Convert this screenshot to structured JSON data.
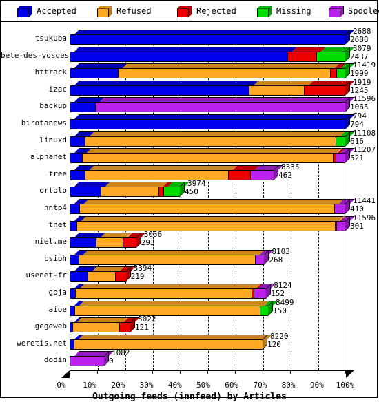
{
  "legend": {
    "items": [
      {
        "label": "Accepted",
        "color": "#0000ee",
        "icon": "cube-icon"
      },
      {
        "label": "Refused",
        "color": "#ffa824",
        "icon": "cube-icon"
      },
      {
        "label": "Rejected",
        "color": "#ee0000",
        "icon": "cube-icon"
      },
      {
        "label": "Missing",
        "color": "#00dd00",
        "icon": "cube-icon"
      },
      {
        "label": "Spooled",
        "color": "#bb22ee",
        "icon": "cube-icon"
      }
    ]
  },
  "axis": {
    "x_title": "Outgoing feeds (innfeed) by Articles",
    "ticks": [
      "0%",
      "10%",
      "20%",
      "30%",
      "40%",
      "50%",
      "60%",
      "70%",
      "80%",
      "90%",
      "100%"
    ]
  },
  "chart_data": {
    "type": "bar",
    "orientation": "horizontal",
    "stacked": true,
    "normalized": true,
    "title": "Outgoing feeds (innfeed) by Articles",
    "xlabel": "Outgoing feeds (innfeed) by Articles",
    "ylabel": "",
    "xlim": [
      0,
      100
    ],
    "xticks": [
      0,
      10,
      20,
      30,
      40,
      50,
      60,
      70,
      80,
      90,
      100
    ],
    "xticklabels": [
      "0%",
      "10%",
      "20%",
      "30%",
      "40%",
      "50%",
      "60%",
      "70%",
      "80%",
      "90%",
      "100%"
    ],
    "grid": "vertical-dashed",
    "legend_position": "top",
    "series_names": [
      "Accepted",
      "Refused",
      "Rejected",
      "Missing",
      "Spooled"
    ],
    "series_colors": [
      "#0000ee",
      "#ffa824",
      "#ee0000",
      "#00dd00",
      "#bb22ee"
    ],
    "categories": [
      "tsukuba",
      "bete-des-vosges",
      "httrack",
      "izac",
      "backup",
      "birotanews",
      "linuxd",
      "alphanet",
      "free",
      "ortolo",
      "nntp4",
      "tnet",
      "niel.me",
      "csiph",
      "usenet-fr",
      "goja",
      "aioe",
      "gegeweb",
      "weretis.net",
      "dodin"
    ],
    "value_labels": [
      {
        "name": "tsukuba",
        "total": "2688",
        "second": "2688"
      },
      {
        "name": "bete-des-vosges",
        "total": "3079",
        "second": "2437"
      },
      {
        "name": "httrack",
        "total": "11419",
        "second": "1999"
      },
      {
        "name": "izac",
        "total": "1919",
        "second": "1245"
      },
      {
        "name": "backup",
        "total": "11596",
        "second": "1065"
      },
      {
        "name": "birotanews",
        "total": "794",
        "second": "794"
      },
      {
        "name": "linuxd",
        "total": "11108",
        "second": "616"
      },
      {
        "name": "alphanet",
        "total": "11207",
        "second": "521"
      },
      {
        "name": "free",
        "total": "8335",
        "second": "462"
      },
      {
        "name": "ortolo",
        "total": "3974",
        "second": "450"
      },
      {
        "name": "nntp4",
        "total": "11441",
        "second": "410"
      },
      {
        "name": "tnet",
        "total": "11596",
        "second": "301"
      },
      {
        "name": "niel.me",
        "total": "3056",
        "second": "293"
      },
      {
        "name": "csiph",
        "total": "8103",
        "second": "268"
      },
      {
        "name": "usenet-fr",
        "total": "3394",
        "second": "219"
      },
      {
        "name": "goja",
        "total": "8124",
        "second": "152"
      },
      {
        "name": "aioe",
        "total": "8499",
        "second": "150"
      },
      {
        "name": "gegeweb",
        "total": "3022",
        "second": "121"
      },
      {
        "name": "weretis.net",
        "total": "8220",
        "second": "120"
      },
      {
        "name": "dodin",
        "total": "1082",
        "second": "0"
      }
    ],
    "rows": [
      {
        "name": "tsukuba",
        "segments": [
          {
            "series": "Accepted",
            "pct": 100.0
          }
        ]
      },
      {
        "name": "bete-des-vosges",
        "segments": [
          {
            "series": "Accepted",
            "pct": 79.1
          },
          {
            "series": "Rejected",
            "pct": 10.4
          },
          {
            "series": "Missing",
            "pct": 10.5
          }
        ]
      },
      {
        "name": "httrack",
        "segments": [
          {
            "series": "Accepted",
            "pct": 17.5
          },
          {
            "series": "Refused",
            "pct": 77.0
          },
          {
            "series": "Rejected",
            "pct": 2.2
          },
          {
            "series": "Missing",
            "pct": 3.3
          }
        ]
      },
      {
        "name": "izac",
        "segments": [
          {
            "series": "Accepted",
            "pct": 64.9
          },
          {
            "series": "Refused",
            "pct": 20.0
          },
          {
            "series": "Rejected",
            "pct": 15.1
          }
        ]
      },
      {
        "name": "backup",
        "segments": [
          {
            "series": "Accepted",
            "pct": 9.2
          },
          {
            "series": "Spooled",
            "pct": 90.8
          }
        ]
      },
      {
        "name": "birotanews",
        "segments": [
          {
            "series": "Accepted",
            "pct": 100.0
          }
        ]
      },
      {
        "name": "linuxd",
        "segments": [
          {
            "series": "Accepted",
            "pct": 5.5
          },
          {
            "series": "Refused",
            "pct": 91.0
          },
          {
            "series": "Missing",
            "pct": 3.5
          }
        ]
      },
      {
        "name": "alphanet",
        "segments": [
          {
            "series": "Accepted",
            "pct": 4.6
          },
          {
            "series": "Refused",
            "pct": 90.8
          },
          {
            "series": "Rejected",
            "pct": 1.1
          },
          {
            "series": "Spooled",
            "pct": 3.5
          }
        ]
      },
      {
        "name": "free",
        "segments": [
          {
            "series": "Accepted",
            "pct": 5.5
          },
          {
            "series": "Refused",
            "pct": 52.0
          },
          {
            "series": "Rejected",
            "pct": 8.0
          },
          {
            "series": "Spooled",
            "pct": 8.5
          }
        ]
      },
      {
        "name": "ortolo",
        "segments": [
          {
            "series": "Accepted",
            "pct": 11.3
          },
          {
            "series": "Refused",
            "pct": 21.0
          },
          {
            "series": "Rejected",
            "pct": 1.8
          },
          {
            "series": "Missing",
            "pct": 5.9
          }
        ]
      },
      {
        "name": "nntp4",
        "segments": [
          {
            "series": "Accepted",
            "pct": 3.6
          },
          {
            "series": "Refused",
            "pct": 92.4
          },
          {
            "series": "Spooled",
            "pct": 4.0
          }
        ]
      },
      {
        "name": "tnet",
        "segments": [
          {
            "series": "Accepted",
            "pct": 2.6
          },
          {
            "series": "Refused",
            "pct": 93.6
          },
          {
            "series": "Rejected",
            "pct": 0.5
          },
          {
            "series": "Spooled",
            "pct": 3.3
          }
        ]
      },
      {
        "name": "niel.me",
        "segments": [
          {
            "series": "Accepted",
            "pct": 9.6
          },
          {
            "series": "Refused",
            "pct": 9.6
          },
          {
            "series": "Rejected",
            "pct": 5.0
          }
        ]
      },
      {
        "name": "csiph",
        "segments": [
          {
            "series": "Accepted",
            "pct": 3.3
          },
          {
            "series": "Refused",
            "pct": 64.0
          },
          {
            "series": "Spooled",
            "pct": 3.3
          }
        ]
      },
      {
        "name": "usenet-fr",
        "segments": [
          {
            "series": "Accepted",
            "pct": 6.4
          },
          {
            "series": "Refused",
            "pct": 10.0
          },
          {
            "series": "Rejected",
            "pct": 4.0
          }
        ]
      },
      {
        "name": "goja",
        "segments": [
          {
            "series": "Accepted",
            "pct": 1.9
          },
          {
            "series": "Refused",
            "pct": 64.0
          },
          {
            "series": "Rejected",
            "pct": 0.9
          },
          {
            "series": "Spooled",
            "pct": 4.5
          }
        ]
      },
      {
        "name": "aioe",
        "segments": [
          {
            "series": "Accepted",
            "pct": 1.8
          },
          {
            "series": "Refused",
            "pct": 67.2
          },
          {
            "series": "Missing",
            "pct": 3.0
          }
        ]
      },
      {
        "name": "gegeweb",
        "segments": [
          {
            "series": "Accepted",
            "pct": 1.0
          },
          {
            "series": "Refused",
            "pct": 17.0
          },
          {
            "series": "Rejected",
            "pct": 4.0
          }
        ]
      },
      {
        "name": "weretis.net",
        "segments": [
          {
            "series": "Accepted",
            "pct": 1.5
          },
          {
            "series": "Refused",
            "pct": 68.5
          }
        ]
      },
      {
        "name": "dodin",
        "segments": [
          {
            "series": "Spooled",
            "pct": 12.5
          }
        ]
      }
    ]
  }
}
